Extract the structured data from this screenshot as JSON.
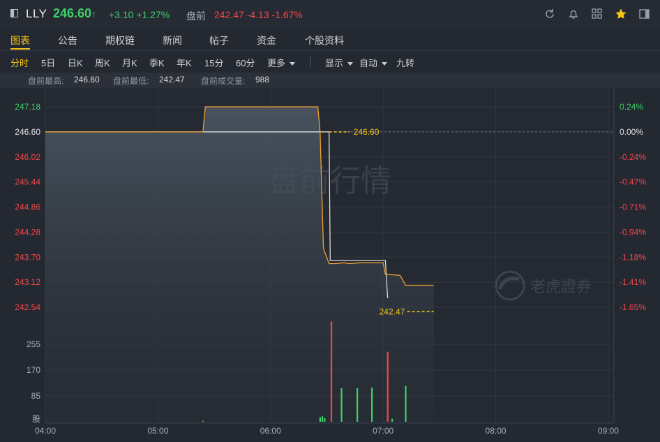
{
  "header": {
    "ticker": "LLY",
    "price": "246.60",
    "arrow": "↑",
    "change": "+3.10 +1.27%",
    "premarket_label": "盘前",
    "premarket_values": "242.47 -4.13 -1.67%",
    "icons": [
      "refresh-icon",
      "bell-icon",
      "grid-icon",
      "star-icon",
      "sidebar-icon"
    ]
  },
  "tabs": [
    "图表",
    "公告",
    "期权链",
    "新闻",
    "帖子",
    "资金",
    "个股资料"
  ],
  "toolbar": {
    "periods": [
      "分时",
      "5日",
      "日K",
      "周K",
      "月K",
      "季K",
      "年K",
      "15分",
      "60分"
    ],
    "more": "更多",
    "display": "显示",
    "auto": "自动",
    "nine_turn": "九转"
  },
  "info": {
    "high_label": "盘前最高:",
    "high": "246.60",
    "low_label": "盘前最低:",
    "low": "242.47",
    "vol_label": "盘前成交量:",
    "vol": "988"
  },
  "colors": {
    "up": "#3fcf6a",
    "down": "#f0484b",
    "accent": "#f5c518",
    "line": "#f0a030",
    "avg": "#e8e8e8"
  },
  "chart_data": {
    "type": "line",
    "y_left_ticks": [
      "247.18",
      "246.60",
      "246.02",
      "245.44",
      "244.86",
      "244.28",
      "243.70",
      "243.12",
      "242.54"
    ],
    "y_right_ticks": [
      "0.24%",
      "0.00%",
      "-0.24%",
      "-0.47%",
      "-0.71%",
      "-0.94%",
      "-1.18%",
      "-1.41%",
      "-1.65%"
    ],
    "ylim": [
      242.54,
      247.18
    ],
    "prev_close": 246.6,
    "x_ticks": [
      "04:00",
      "05:00",
      "06:00",
      "07:00",
      "08:00",
      "09:00"
    ],
    "xlim_hours": [
      4,
      9.05
    ],
    "price_series": [
      [
        4.0,
        246.6
      ],
      [
        5.4,
        246.6
      ],
      [
        5.42,
        247.18
      ],
      [
        6.42,
        247.18
      ],
      [
        6.44,
        246.6
      ],
      [
        6.47,
        243.9
      ],
      [
        6.52,
        243.55
      ],
      [
        6.58,
        243.55
      ],
      [
        6.65,
        243.57
      ],
      [
        6.7,
        243.55
      ],
      [
        6.8,
        243.57
      ],
      [
        7.0,
        243.57
      ],
      [
        7.02,
        243.3
      ],
      [
        7.15,
        243.28
      ],
      [
        7.2,
        243.05
      ],
      [
        7.45,
        243.05
      ]
    ],
    "avg_series": [
      [
        4.0,
        246.6
      ],
      [
        6.52,
        246.6
      ],
      [
        6.53,
        243.62
      ],
      [
        7.02,
        243.62
      ],
      [
        7.04,
        242.75
      ]
    ],
    "marker_high": "246.60",
    "marker_low": "242.47",
    "watermark": "盘前行情",
    "brand": "老虎證券",
    "volume_ticks": [
      "255",
      "170",
      "85"
    ],
    "volume_unit": "股",
    "volume_max": 340,
    "volume_bars": [
      {
        "t": 5.4,
        "v": 3,
        "c": "green"
      },
      {
        "t": 6.44,
        "v": 15,
        "c": "green"
      },
      {
        "t": 6.46,
        "v": 18,
        "c": "green"
      },
      {
        "t": 6.48,
        "v": 12,
        "c": "green"
      },
      {
        "t": 6.54,
        "v": 330,
        "c": "red"
      },
      {
        "t": 6.63,
        "v": 110,
        "c": "green"
      },
      {
        "t": 6.77,
        "v": 110,
        "c": "green"
      },
      {
        "t": 6.9,
        "v": 112,
        "c": "green"
      },
      {
        "t": 7.04,
        "v": 230,
        "c": "red"
      },
      {
        "t": 7.08,
        "v": 10,
        "c": "green"
      },
      {
        "t": 7.2,
        "v": 118,
        "c": "green"
      }
    ]
  }
}
